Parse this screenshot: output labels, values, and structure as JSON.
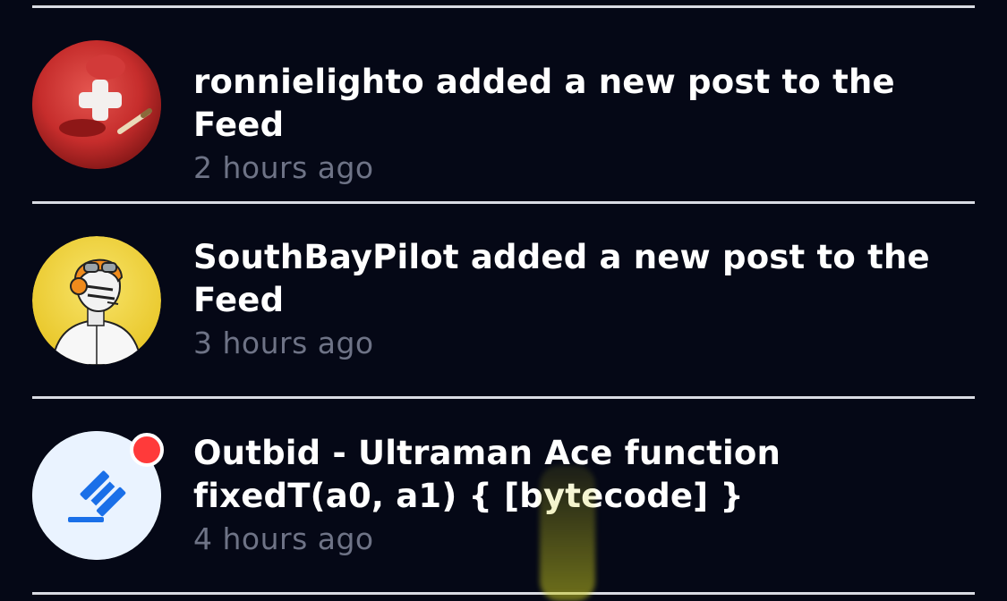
{
  "feed": {
    "items": [
      {
        "title": "ronnielighto added a new post to the Feed",
        "time": "2 hours ago",
        "avatar": "red-ball-avatar"
      },
      {
        "title": "SouthBayPilot added a new post to the Feed",
        "time": "3 hours ago",
        "avatar": "pilot-avatar"
      },
      {
        "title": "Outbid - Ultraman Ace function fixedT(a0, a1) { [bytecode] }",
        "time": "4 hours ago",
        "avatar": "auction-gavel-icon",
        "unread": true
      }
    ]
  },
  "colors": {
    "background": "#050816",
    "title_text": "#ffffff",
    "time_text": "#6e7386",
    "divider": "#d9dbe3",
    "gavel_blue": "#1a6fe8",
    "notification_red": "#ff3a3a"
  }
}
